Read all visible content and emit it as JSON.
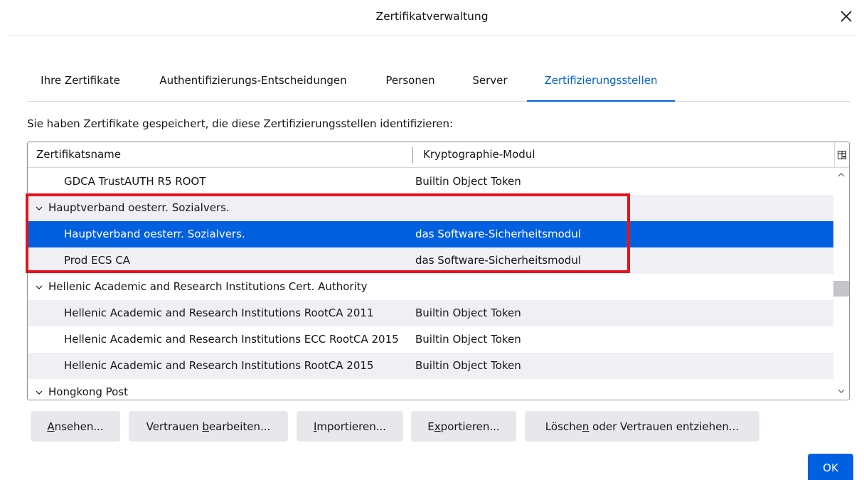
{
  "dialog": {
    "title": "Zertifikatverwaltung"
  },
  "tabs": [
    {
      "label": "Ihre Zertifikate",
      "active": false
    },
    {
      "label": "Authentifizierungs-Entscheidungen",
      "active": false
    },
    {
      "label": "Personen",
      "active": false
    },
    {
      "label": "Server",
      "active": false
    },
    {
      "label": "Zertifizierungsstellen",
      "active": true
    }
  ],
  "intro": "Sie haben Zertifikate gespeichert, die diese Zertifizierungsstellen identifizieren:",
  "tree": {
    "columns": [
      "Zertifikatsname",
      "Kryptographie-Modul"
    ],
    "rows": [
      {
        "type": "child",
        "name": "GDCA TrustAUTH R5 ROOT",
        "module": "Builtin Object Token"
      },
      {
        "type": "group",
        "name": "Hauptverband oesterr. Sozialvers.",
        "module": ""
      },
      {
        "type": "child",
        "name": "Hauptverband oesterr. Sozialvers.",
        "module": "das Software-Sicherheitsmodul",
        "selected": true
      },
      {
        "type": "child",
        "name": "Prod ECS CA",
        "module": "das Software-Sicherheitsmodul"
      },
      {
        "type": "group",
        "name": "Hellenic Academic and Research Institutions Cert. Authority",
        "module": ""
      },
      {
        "type": "child",
        "name": "Hellenic Academic and Research Institutions RootCA 2011",
        "module": "Builtin Object Token"
      },
      {
        "type": "child",
        "name": "Hellenic Academic and Research Institutions ECC RootCA 2015",
        "module": "Builtin Object Token"
      },
      {
        "type": "child",
        "name": "Hellenic Academic and Research Institutions RootCA 2015",
        "module": "Builtin Object Token"
      },
      {
        "type": "group",
        "name": "Hongkong Post",
        "module": ""
      }
    ]
  },
  "buttons": {
    "view": {
      "accel": "A",
      "rest": "nsehen..."
    },
    "edit_trust": {
      "pre": "Vertrauen ",
      "accel": "b",
      "rest": "earbeiten..."
    },
    "import": {
      "accel": "I",
      "rest": "mportieren..."
    },
    "export": {
      "pre": "E",
      "accel": "x",
      "rest": "portieren..."
    },
    "delete": {
      "pre": "Lösche",
      "accel": "n",
      "rest": " oder Vertrauen entziehen..."
    }
  },
  "ok_label": "OK",
  "colors": {
    "accent": "#0060df",
    "highlight": "#e5121d",
    "button_bg": "#e8e8ec",
    "alt_row": "#f0f0f4"
  }
}
